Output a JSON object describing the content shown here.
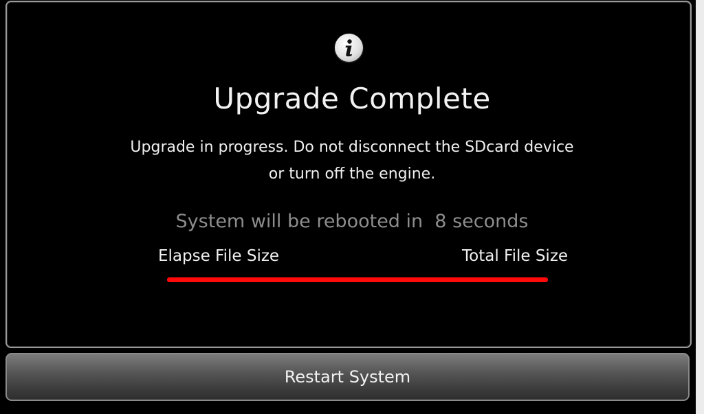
{
  "dialog": {
    "icon": "info-icon",
    "title": "Upgrade Complete",
    "message_line1": "Upgrade in progress. Do not disconnect the SDcard device",
    "message_line2": "or turn off the engine.",
    "reboot_notice": "System will be rebooted in  8 seconds"
  },
  "progress": {
    "elapsed_label": "Elapse File Size",
    "total_label": "Total File Size",
    "fraction": 1.0,
    "bar_color": "#ff0a0a"
  },
  "actions": {
    "restart_label": "Restart System"
  }
}
